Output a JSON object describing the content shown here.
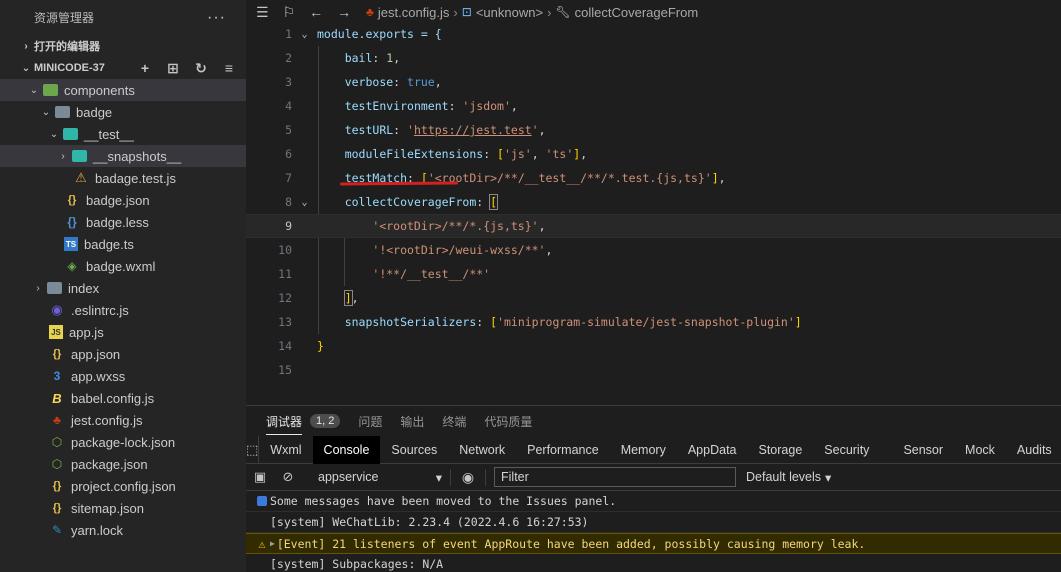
{
  "explorer": {
    "title": "资源管理器",
    "more": "···",
    "open_editors": "打开的编辑器",
    "project": "MINICODE-37",
    "items": [
      {
        "name": "components"
      },
      {
        "name": "badge"
      },
      {
        "name": "__test__"
      },
      {
        "name": "__snapshots__"
      },
      {
        "name": "badage.test.js"
      },
      {
        "name": "badge.json"
      },
      {
        "name": "badge.less"
      },
      {
        "name": "badge.ts"
      },
      {
        "name": "badge.wxml"
      },
      {
        "name": "index"
      },
      {
        "name": ".eslintrc.js"
      },
      {
        "name": "app.js"
      },
      {
        "name": "app.json"
      },
      {
        "name": "app.wxss"
      },
      {
        "name": "babel.config.js"
      },
      {
        "name": "jest.config.js"
      },
      {
        "name": "package-lock.json"
      },
      {
        "name": "package.json"
      },
      {
        "name": "project.config.json"
      },
      {
        "name": "sitemap.json"
      },
      {
        "name": "yarn.lock"
      }
    ]
  },
  "breadcrumb": {
    "file": "jest.config.js",
    "scope": "<unknown>",
    "symbol": "collectCoverageFrom"
  },
  "editor": {
    "current_line": 9,
    "line_numbers": [
      "1",
      "2",
      "3",
      "4",
      "5",
      "6",
      "7",
      "8",
      "9",
      "10",
      "11",
      "12",
      "13",
      "14",
      "15"
    ],
    "lines": {
      "l1": "module.exports = {",
      "bail_key": "bail",
      "bail_val": "1",
      "verbose_key": "verbose",
      "verbose_val": "true",
      "testenv_key": "testEnvironment",
      "testenv_val": "'jsdom'",
      "testurl_key": "testURL",
      "testurl_val": "https://jest.test",
      "mfe_key": "moduleFileExtensions",
      "mfe_v1": "'js'",
      "mfe_v2": "'ts'",
      "tm_key": "testMatch",
      "tm_val": "'<rootDir>/**/__test__/**/*.test.{js,ts}'",
      "ccf_key": "collectCoverageFrom",
      "ccf_v1": "'<rootDir>/**/*.{js,ts}'",
      "ccf_v2": "'!<rootDir>/weui-wxss/**'",
      "ccf_v3": "'!**/__test__/**'",
      "ss_key": "snapshotSerializers",
      "ss_val": "'miniprogram-simulate/jest-snapshot-plugin'"
    }
  },
  "panel": {
    "tabs": [
      "调试器",
      "问题",
      "输出",
      "终端",
      "代码质量"
    ],
    "badge": "1, 2",
    "devtools_tabs": [
      "Wxml",
      "Console",
      "Sources",
      "Network",
      "Performance",
      "Memory",
      "AppData",
      "Storage",
      "Security",
      "Sensor",
      "Mock",
      "Audits"
    ],
    "active_devtools_tab": "Console",
    "context": "appservice",
    "filter_placeholder": "Filter",
    "levels": "Default levels",
    "messages": [
      {
        "type": "info",
        "text": "Some messages have been moved to the Issues panel."
      },
      {
        "type": "log",
        "text": "[system] WeChatLib: 2.23.4 (2022.4.6 16:27:53)"
      },
      {
        "type": "warn",
        "text": "[Event] 21 listeners of event AppRoute have been added, possibly causing memory leak."
      },
      {
        "type": "log",
        "text": "[system] Subpackages: N/A"
      }
    ]
  }
}
